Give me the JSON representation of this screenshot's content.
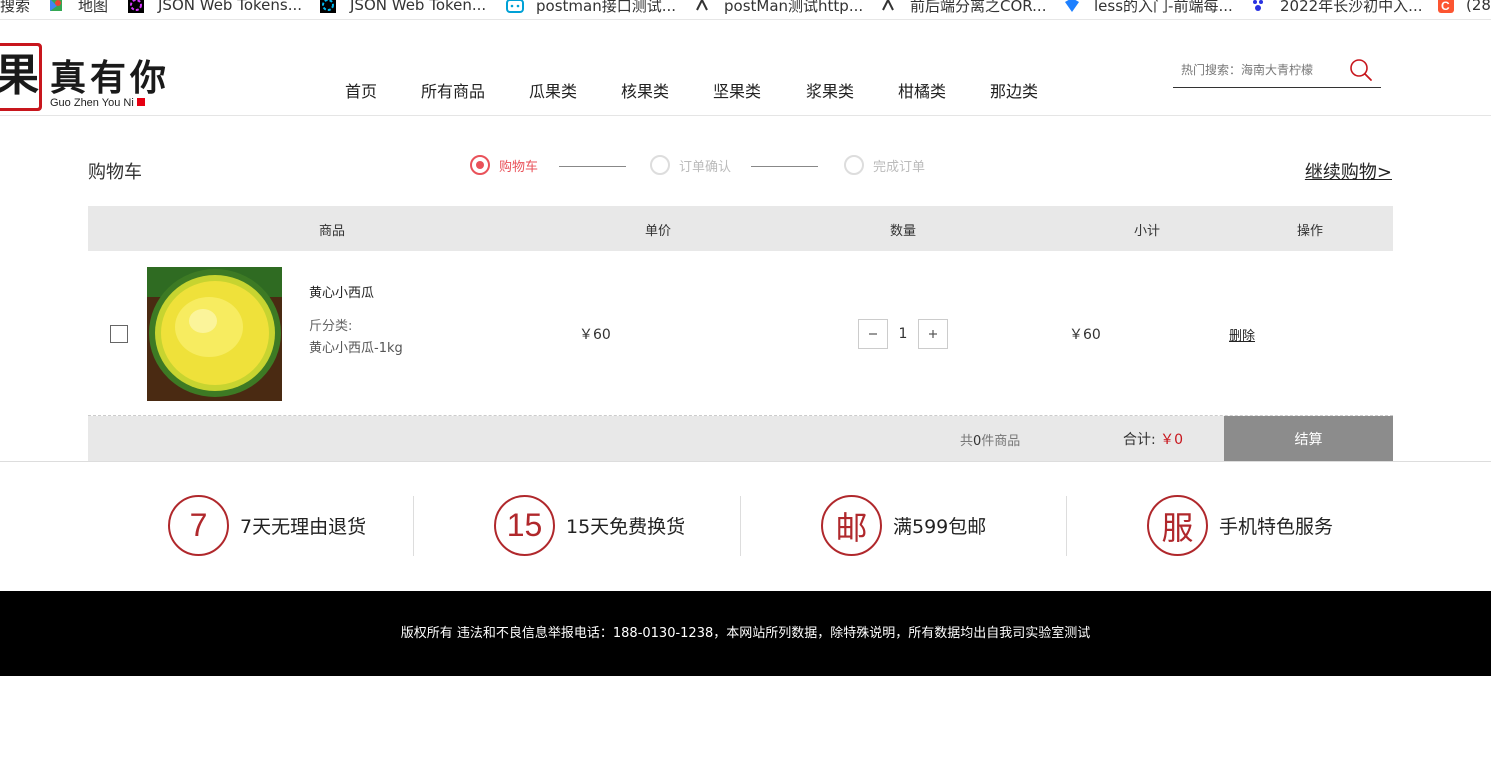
{
  "bookmarks": [
    {
      "label": "搜索",
      "icon": "none"
    },
    {
      "label": "地图",
      "icon": "maps-icon"
    },
    {
      "label": "JSON Web Tokens...",
      "icon": "jwt-icon"
    },
    {
      "label": "JSON Web Token...",
      "icon": "jwt-icon"
    },
    {
      "label": "postman接口测试...",
      "icon": "bilibili-icon"
    },
    {
      "label": "postMan测试http...",
      "icon": "cnblogs-icon"
    },
    {
      "label": "前后端分离之COR...",
      "icon": "cnblogs-icon"
    },
    {
      "label": "less的入门-前端每...",
      "icon": "shield-icon"
    },
    {
      "label": "2022年长沙初中入...",
      "icon": "baidu-icon"
    },
    {
      "label": "(28",
      "icon": "csdn-icon"
    }
  ],
  "header": {
    "logo_char": "果",
    "logo_text": "真有你",
    "logo_sub": "Guo Zhen You Ni",
    "nav": [
      "首页",
      "所有商品",
      "瓜果类",
      "核果类",
      "坚果类",
      "浆果类",
      "柑橘类",
      "那边类"
    ],
    "search_placeholder": "热门搜索：海南大青柠檬"
  },
  "cart": {
    "title": "购物车",
    "steps": [
      "购物车",
      "订单确认",
      "完成订单"
    ],
    "continue_label": "继续购物>",
    "columns": [
      "商品",
      "单价",
      "数量",
      "小计",
      "操作"
    ],
    "items": [
      {
        "name": "黄心小西瓜",
        "spec_label": "斤分类:",
        "spec_value": "黄心小西瓜-1kg",
        "price": "￥60",
        "qty": "1",
        "subtotal": "￥60",
        "delete_label": "删除"
      }
    ],
    "count_prefix": "共",
    "count_value": "0",
    "count_suffix": "件商品",
    "total_label": "合计: ",
    "total_amount": "￥0",
    "checkout_label": "结算"
  },
  "services": [
    {
      "symbol": "7",
      "text": "7天无理由退货"
    },
    {
      "symbol": "15",
      "text": "15天免费换货"
    },
    {
      "symbol": "邮",
      "text": "满599包邮"
    },
    {
      "symbol": "服",
      "text": "手机特色服务"
    }
  ],
  "footer": {
    "text": "版权所有 违法和不良信息举报电话：188-0130-1238，本网站所列数据，除特殊说明，所有数据均出自我司实验室测试"
  },
  "colors": {
    "accent": "#e9525a",
    "brand_red": "#c8161d",
    "service_red": "#b0282c",
    "checkout_gray": "#8c8c8c"
  }
}
